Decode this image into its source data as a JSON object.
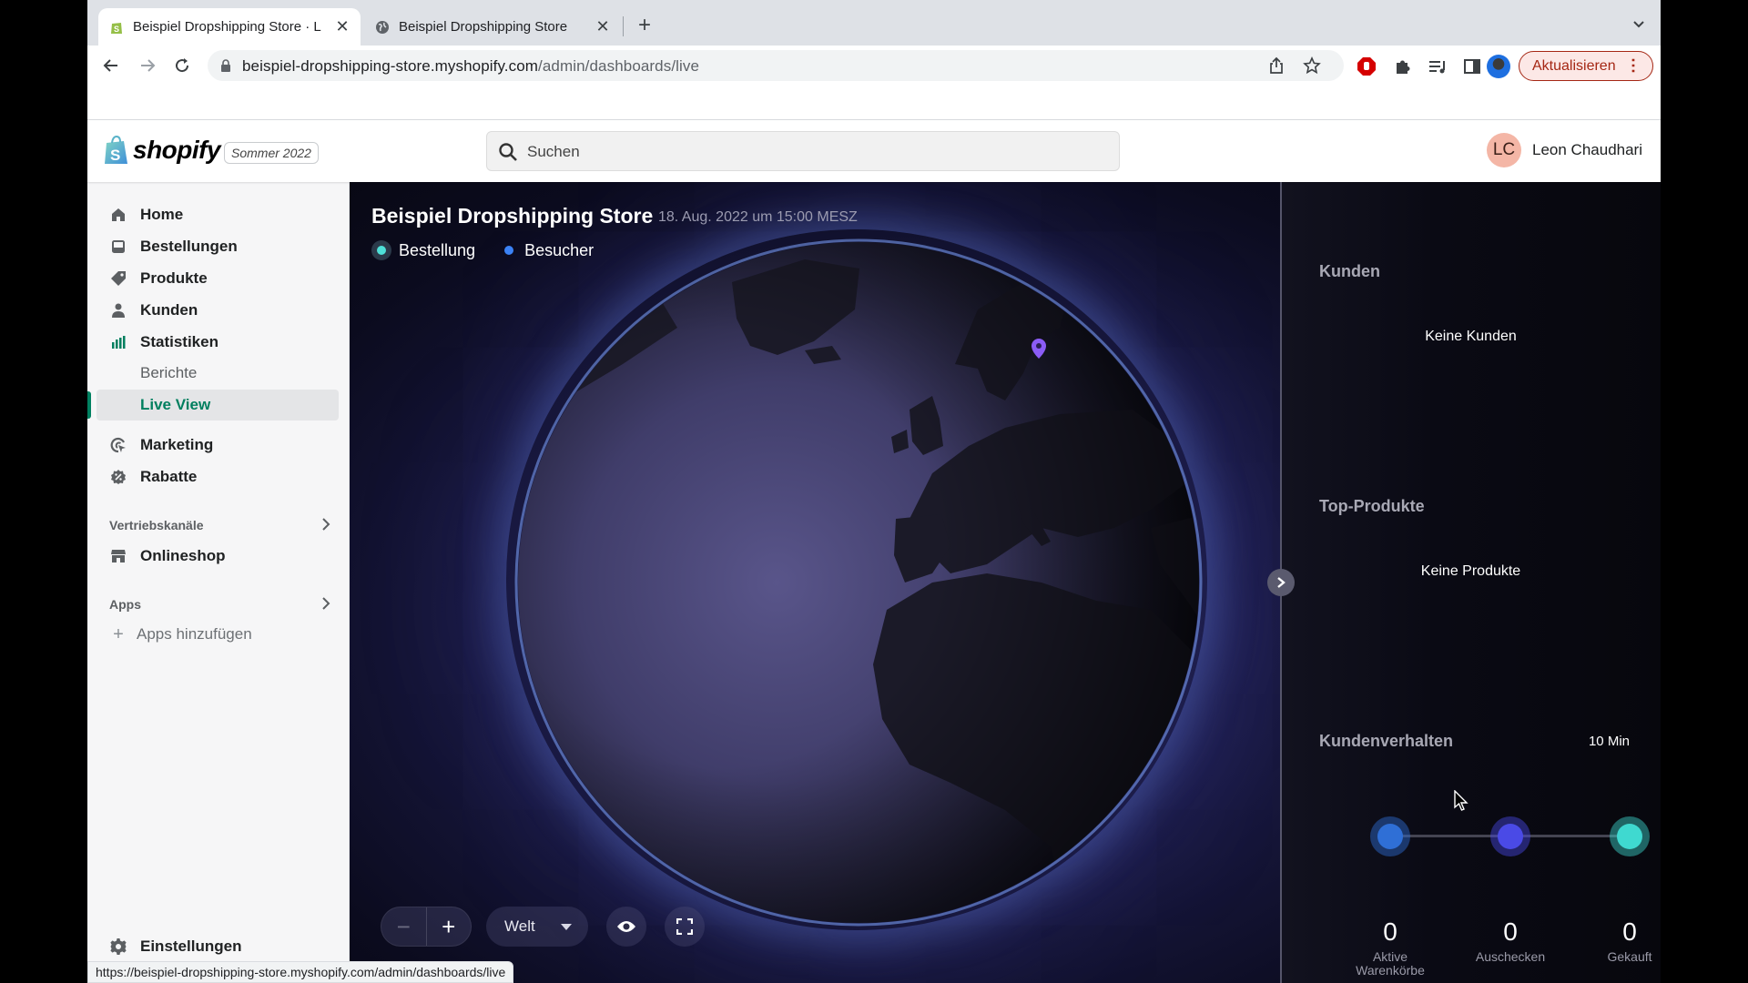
{
  "browser": {
    "tabs": [
      {
        "title": "Beispiel Dropshipping Store · L",
        "active": true,
        "icon": "shopify-bag-icon"
      },
      {
        "title": "Beispiel Dropshipping Store",
        "active": false,
        "icon": "globe-icon"
      }
    ],
    "url_host": "beispiel-dropshipping-store.myshopify.com",
    "url_path": "/admin/dashboards/live",
    "update_label": "Aktualisieren",
    "status_url": "https://beispiel-dropshipping-store.myshopify.com/admin/dashboards/live"
  },
  "topbar": {
    "logo_text": "shopify",
    "edition": "Sommer 2022",
    "search_placeholder": "Suchen",
    "user_initials": "LC",
    "user_name": "Leon Chaudhari"
  },
  "sidebar": {
    "items": [
      {
        "label": "Home",
        "icon": "home-icon"
      },
      {
        "label": "Bestellungen",
        "icon": "inbox-icon"
      },
      {
        "label": "Produkte",
        "icon": "tag-icon"
      },
      {
        "label": "Kunden",
        "icon": "person-icon"
      },
      {
        "label": "Statistiken",
        "icon": "bar-chart-icon"
      }
    ],
    "sub_items": [
      {
        "label": "Berichte",
        "active": false
      },
      {
        "label": "Live View",
        "active": true
      }
    ],
    "items2": [
      {
        "label": "Marketing",
        "icon": "target-icon"
      },
      {
        "label": "Rabatte",
        "icon": "discount-icon"
      }
    ],
    "sales_channels_heading": "Vertriebskanäle",
    "online_store": "Onlineshop",
    "apps_heading": "Apps",
    "add_apps": "Apps hinzufügen",
    "settings": "Einstellungen"
  },
  "liveview": {
    "store_name": "Beispiel Dropshipping Store",
    "timestamp": "18. Aug. 2022 um 15:00 MESZ",
    "legend": {
      "orders": "Bestellung",
      "visitors": "Besucher"
    },
    "colors": {
      "order": "#4ee0d8",
      "visitor": "#3b82f6",
      "pin": "#8b5cf6"
    },
    "map_view": "Welt",
    "customers_heading": "Kunden",
    "customers_empty": "Keine Kunden",
    "products_heading": "Top-Produkte",
    "products_empty": "Keine Produkte",
    "behavior_heading": "Kundenverhalten",
    "behavior_period": "10 Min",
    "funnel": [
      {
        "label": "Aktive Warenkörbe",
        "value": "0",
        "color": "#2f6fd6"
      },
      {
        "label": "Auschecken",
        "value": "0",
        "color": "#4a4ae6"
      },
      {
        "label": "Gekauft",
        "value": "0",
        "color": "#3fd9d0"
      }
    ]
  }
}
